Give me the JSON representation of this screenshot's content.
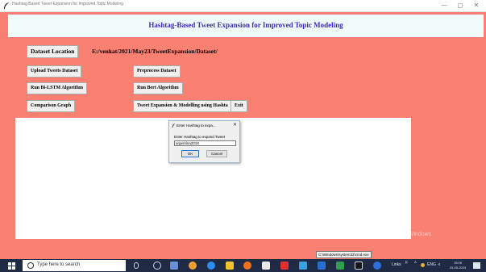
{
  "window": {
    "title": "Hashtag-Based Tweet Expansion for Improved Topic Modeling",
    "controls": {
      "minimize": "—",
      "maximize": "◻",
      "close": "✕"
    }
  },
  "app": {
    "heading": "Hashtag-Based Tweet Expansion for Improved Topic Modeling",
    "dataset_label": "Dataset Location",
    "dataset_path": "E:/venkat/2021/May23/TweetExpansion/Dataset/",
    "buttons": {
      "upload": "Upload Tweets Dataset",
      "preprocess": "Preprocess Dataset",
      "bilstm": "Run Bi-LSTM Algorithm",
      "bert": "Run Bert Algorithm",
      "graph": "Comparison Graph",
      "expansion": "Tweet Expansion & Modelling using Hashta",
      "exit": "Exit"
    }
  },
  "dialog": {
    "title": "Enter Hashtag to expa...",
    "close": "✕",
    "prompt": "Enter Hashtag to expand Tweet",
    "input_value": "argentina2018",
    "ok": "OK",
    "cancel": "Cancel"
  },
  "watermark": "Activate Windows",
  "cmd_tooltip": "C:\\Windows\\system32\\cmd.exe",
  "taskbar": {
    "search_placeholder": "Type here to search",
    "links_label": "Links",
    "tray_text": "ENG",
    "time": "15:05",
    "date": "23-05-2023"
  },
  "colors": {
    "background": "#fa8072",
    "banner": "#f0fbfb",
    "heading": "#3f2bbf",
    "taskbar": "#1f2a44"
  }
}
